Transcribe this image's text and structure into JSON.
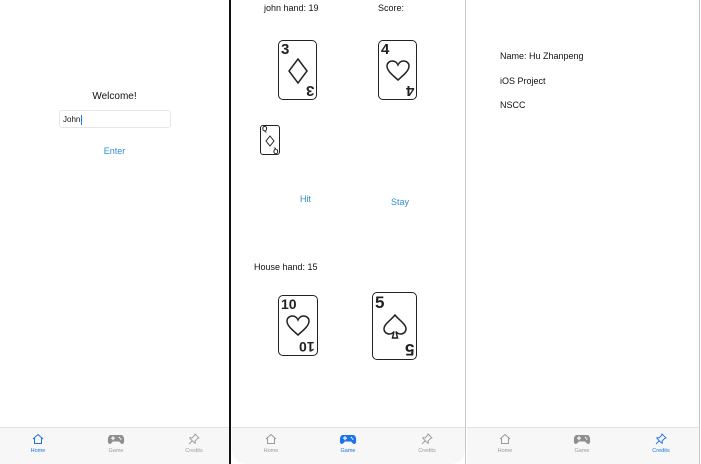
{
  "home": {
    "welcome": "Welcome!",
    "name_value": "John",
    "enter_label": "Enter"
  },
  "game": {
    "player_hand": "john hand: 19",
    "score_label": "Score:",
    "hit_label": "Hit",
    "stay_label": "Stay",
    "house_hand": "House hand: 15",
    "player_cards": [
      {
        "rank": "3",
        "suit": "diamond"
      },
      {
        "rank": "4",
        "suit": "heart"
      },
      {
        "rank": "Q",
        "suit": "diamond"
      }
    ],
    "house_cards": [
      {
        "rank": "10",
        "suit": "heart"
      },
      {
        "rank": "5",
        "suit": "spade"
      }
    ]
  },
  "credits": {
    "line1": "Name: Hu Zhanpeng",
    "line2": "iOS Project",
    "line3": "NSCC"
  },
  "tabs": {
    "home": "Home",
    "game": "Game",
    "credits": "Credits"
  },
  "colors": {
    "accent": "#1a73e8",
    "link": "#2f8fd1",
    "tab_inactive": "#9a9a9a"
  }
}
